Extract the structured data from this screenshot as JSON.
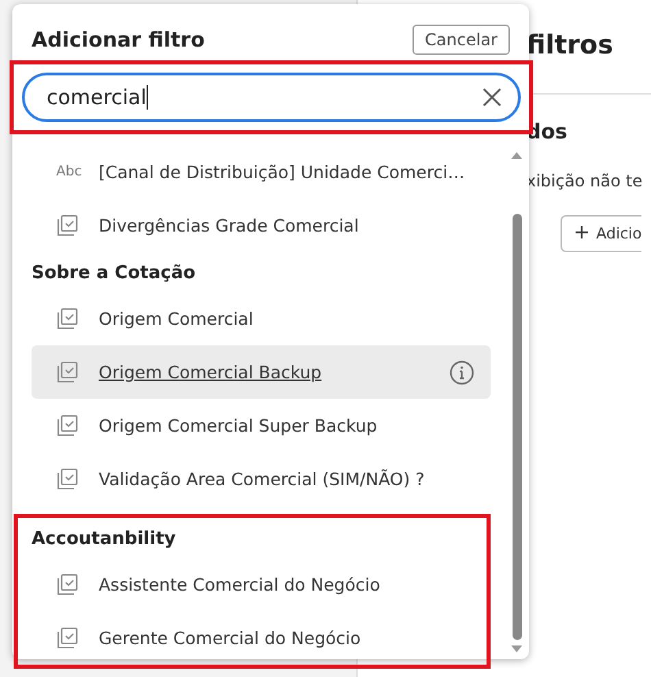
{
  "background": {
    "title": "filtros",
    "section": "dos",
    "message": "xibição não te",
    "add_button": "Adicio"
  },
  "dialog": {
    "title": "Adicionar filtro",
    "cancel": "Cancelar",
    "search": {
      "value": "comercial",
      "highlighted": true
    },
    "groups": [
      {
        "highlighted": false,
        "items": [
          {
            "kind": "text",
            "badge": "Abc",
            "label": "[Canal de Distribuição] Unidade Comerci…",
            "hovered": false,
            "info": false
          },
          {
            "kind": "measure",
            "label": "Divergências Grade Comercial",
            "hovered": false,
            "info": false
          }
        ]
      },
      {
        "heading": "Sobre a Cotação",
        "highlighted": false,
        "items": [
          {
            "kind": "measure",
            "label": "Origem Comercial",
            "hovered": false,
            "info": false
          },
          {
            "kind": "measure",
            "label": "Origem Comercial Backup",
            "hovered": true,
            "info": true
          },
          {
            "kind": "measure",
            "label": "Origem Comercial Super Backup",
            "hovered": false,
            "info": false
          },
          {
            "kind": "measure",
            "label": "Validação Area Comercial (SIM/NÃO) ?",
            "hovered": false,
            "info": false
          }
        ]
      },
      {
        "heading": "Accoutanbility",
        "highlighted": true,
        "items": [
          {
            "kind": "measure",
            "label": "Assistente Comercial do Negócio",
            "hovered": false,
            "info": false
          },
          {
            "kind": "measure",
            "label": "Gerente Comercial do Negócio",
            "hovered": false,
            "info": false
          }
        ]
      }
    ]
  }
}
